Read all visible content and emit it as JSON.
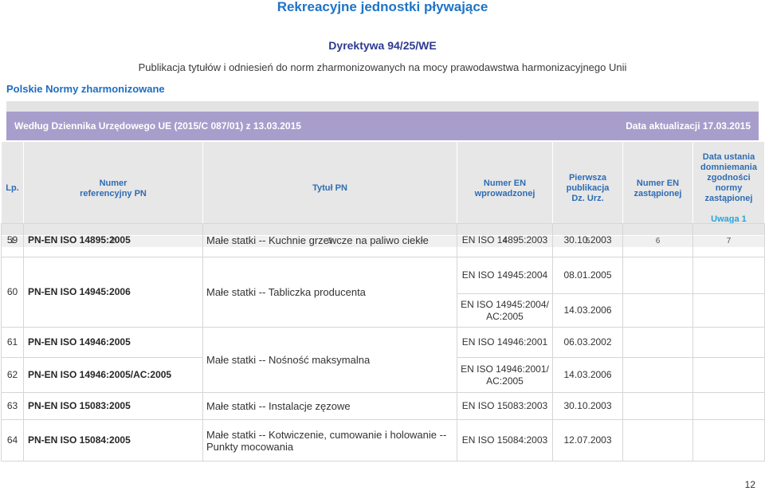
{
  "document": {
    "title": "Rekreacyjne jednostki pływające",
    "directive": "Dyrektywa 94/25/WE",
    "subtitle": "Publikacja tytułów i odniesień do norm zharmonizowanych na mocy prawodawstwa harmonizacyjnego Unii",
    "section": "Polskie Normy zharmonizowane",
    "page_number": "12"
  },
  "banner": {
    "source": "Według Dziennika Urzędowego UE (2015/C 087/01) z 13.03.2015",
    "updated": "Data aktualizacji 17.03.2015"
  },
  "table": {
    "headers": {
      "lp": "Lp.",
      "pn_number": "Numer\nreferencyjny PN",
      "pn_title": "Tytuł PN",
      "en_introduced": "Numer EN\nwprowadzonej",
      "first_publication": "Pierwsza\npublikacja\nDz. Urz.",
      "en_replaced": "Numer EN\nzastąpionej",
      "cessation_date": "Data ustania\ndomniemania\nzgodności\nnormy\nzastąpionej",
      "cessation_note": "Uwaga 1"
    },
    "column_numbers": [
      "1",
      "2",
      "3",
      "4",
      "5",
      "6",
      "7"
    ],
    "rows": [
      {
        "lp": "59",
        "pn_number": "PN-EN ISO 14895:2005",
        "pn_title": "Małe statki -- Kuchnie grzewcze na paliwo ciekłe",
        "en_introduced": [
          "EN ISO 14895:2003"
        ],
        "first_publication": [
          "30.10.2003"
        ]
      },
      {
        "lp": "60",
        "pn_number": "PN-EN ISO 14945:2006",
        "pn_title": "Małe statki -- Tabliczka producenta",
        "en_introduced": [
          "EN ISO 14945:2004",
          "EN ISO 14945:2004/\nAC:2005"
        ],
        "first_publication": [
          "08.01.2005",
          "14.03.2006"
        ]
      },
      {
        "lp": "61",
        "pn_number": "PN-EN ISO 14946:2005",
        "pn_title": "Małe statki -- Nośność maksymalna",
        "en_introduced": [
          "EN ISO 14946:2001"
        ],
        "first_publication": [
          "06.03.2002"
        ]
      },
      {
        "lp": "62",
        "pn_number": "PN-EN ISO 14946:2005/AC:2005",
        "en_introduced": [
          "EN ISO 14946:2001/\nAC:2005"
        ],
        "first_publication": [
          "14.03.2006"
        ]
      },
      {
        "lp": "63",
        "pn_number": "PN-EN ISO 15083:2005",
        "pn_title": "Małe statki -- Instalacje zęzowe",
        "en_introduced": [
          "EN ISO 15083:2003"
        ],
        "first_publication": [
          "30.10.2003"
        ]
      },
      {
        "lp": "64",
        "pn_number": "PN-EN ISO 15084:2005",
        "pn_title": "Małe statki -- Kotwiczenie, cumowanie i holowanie -- Punkty mocowania",
        "en_introduced": [
          "EN ISO 15084:2003"
        ],
        "first_publication": [
          "12.07.2003"
        ]
      }
    ]
  },
  "colors": {
    "title_blue": "#1f74c6",
    "directive_blue": "#2e3a91",
    "section_blue": "#1e6dc1",
    "banner_purple": "#a89ecc",
    "header_bg": "#e7e7e7",
    "header_text": "#2f6cb3",
    "note_blue": "#2aa3dc",
    "grid_line": "#d6d6d6"
  }
}
